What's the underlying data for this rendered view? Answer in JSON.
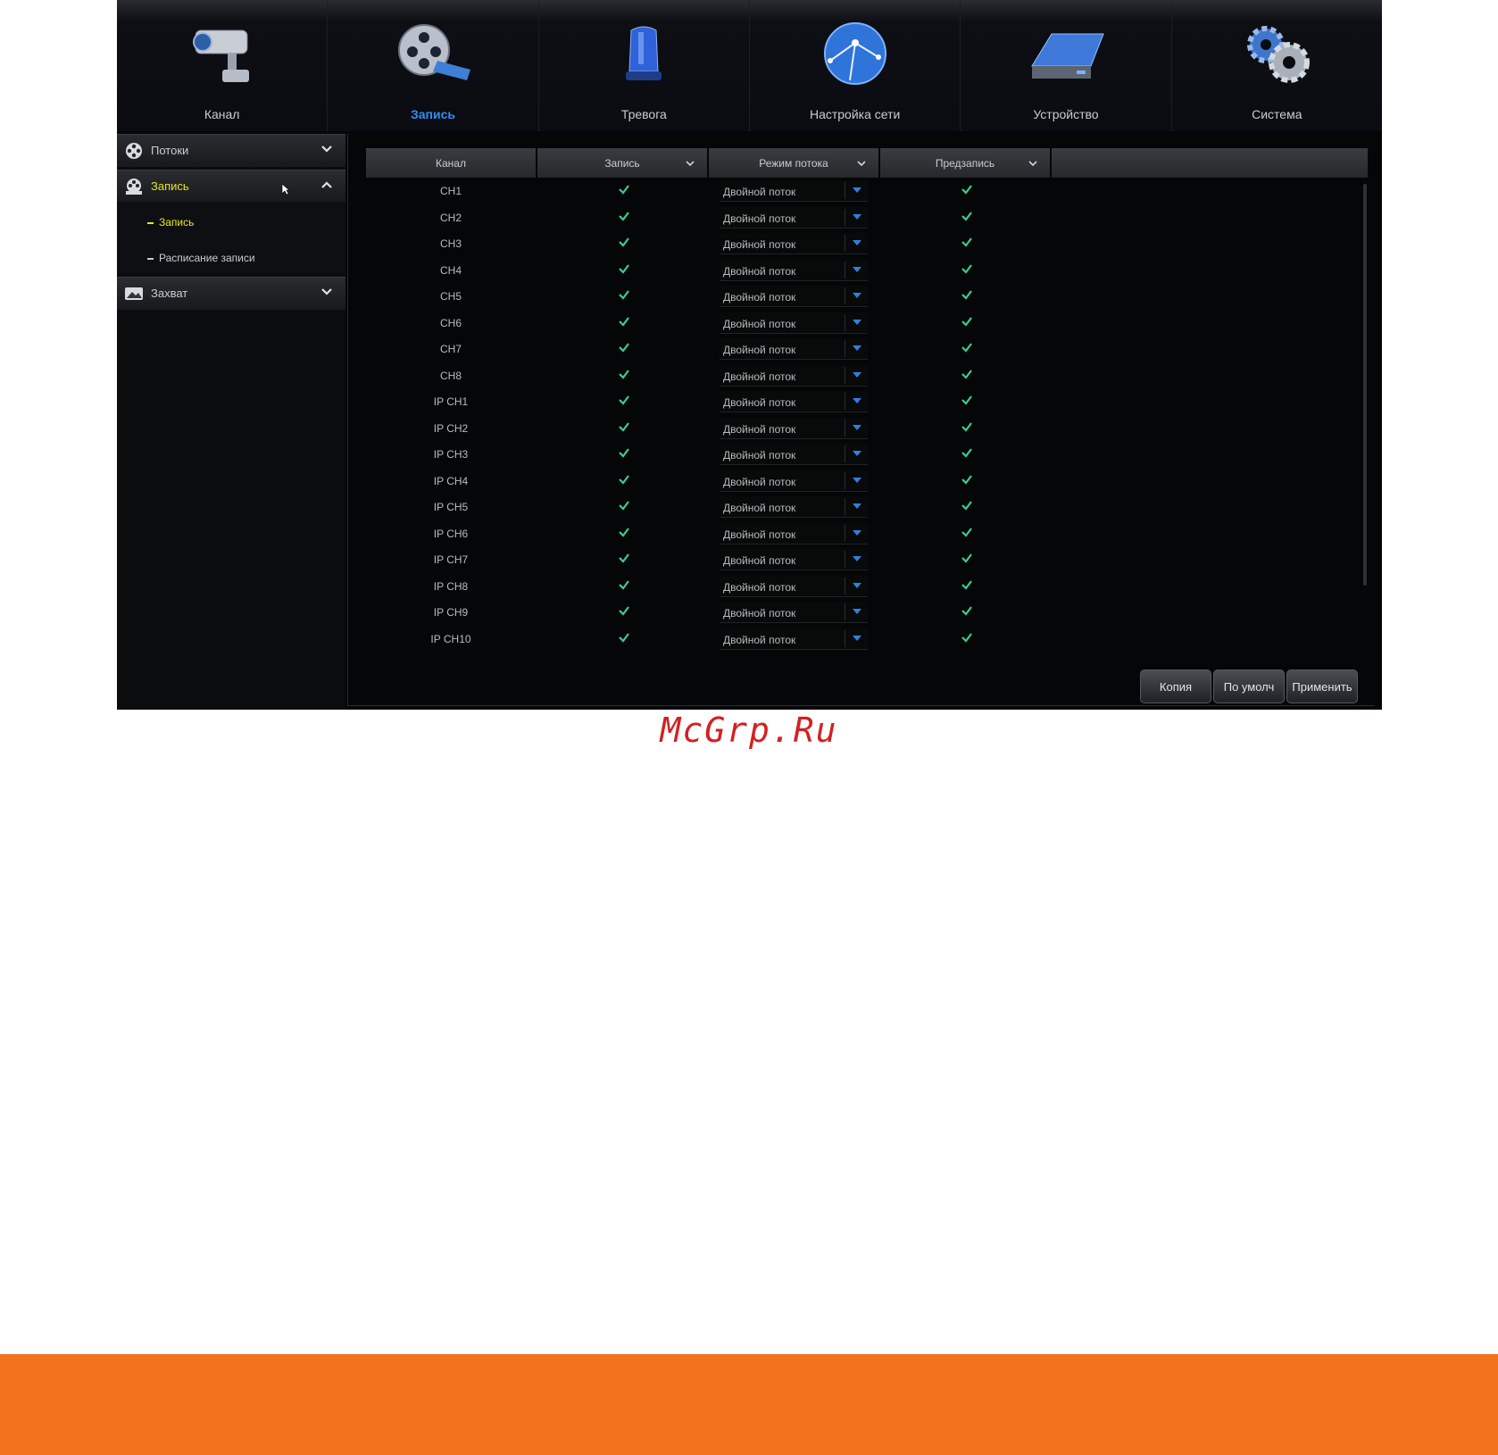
{
  "nav": {
    "tabs": [
      {
        "label": "Канал",
        "icon": "camera-icon"
      },
      {
        "label": "Запись",
        "icon": "film-reel-icon",
        "active": true
      },
      {
        "label": "Тревога",
        "icon": "alarm-siren-icon"
      },
      {
        "label": "Настройка сети",
        "icon": "globe-network-icon"
      },
      {
        "label": "Устройство",
        "icon": "hard-drive-icon"
      },
      {
        "label": "Система",
        "icon": "gears-icon"
      }
    ]
  },
  "sidebar": {
    "sections": [
      {
        "label": "Потоки",
        "icon": "film-icon",
        "expanded": false
      },
      {
        "label": "Запись",
        "icon": "record-reel-icon",
        "expanded": true,
        "items": [
          {
            "label": "Запись",
            "active": true
          },
          {
            "label": "Расписание записи",
            "active": false
          }
        ]
      },
      {
        "label": "Захват",
        "icon": "capture-image-icon",
        "expanded": false
      }
    ]
  },
  "table": {
    "columns": [
      "Канал",
      "Запись",
      "Режим потока",
      "Предзапись"
    ],
    "rows": [
      {
        "channel": "CH1",
        "record": true,
        "mode": "Двойной поток",
        "prerecord": true
      },
      {
        "channel": "CH2",
        "record": true,
        "mode": "Двойной поток",
        "prerecord": true
      },
      {
        "channel": "CH3",
        "record": true,
        "mode": "Двойной поток",
        "prerecord": true
      },
      {
        "channel": "CH4",
        "record": true,
        "mode": "Двойной поток",
        "prerecord": true
      },
      {
        "channel": "CH5",
        "record": true,
        "mode": "Двойной поток",
        "prerecord": true
      },
      {
        "channel": "CH6",
        "record": true,
        "mode": "Двойной поток",
        "prerecord": true
      },
      {
        "channel": "CH7",
        "record": true,
        "mode": "Двойной поток",
        "prerecord": true
      },
      {
        "channel": "CH8",
        "record": true,
        "mode": "Двойной поток",
        "prerecord": true
      },
      {
        "channel": "IP CH1",
        "record": true,
        "mode": "Двойной поток",
        "prerecord": true
      },
      {
        "channel": "IP CH2",
        "record": true,
        "mode": "Двойной поток",
        "prerecord": true
      },
      {
        "channel": "IP CH3",
        "record": true,
        "mode": "Двойной поток",
        "prerecord": true
      },
      {
        "channel": "IP CH4",
        "record": true,
        "mode": "Двойной поток",
        "prerecord": true
      },
      {
        "channel": "IP CH5",
        "record": true,
        "mode": "Двойной поток",
        "prerecord": true
      },
      {
        "channel": "IP CH6",
        "record": true,
        "mode": "Двойной поток",
        "prerecord": true
      },
      {
        "channel": "IP CH7",
        "record": true,
        "mode": "Двойной поток",
        "prerecord": true
      },
      {
        "channel": "IP CH8",
        "record": true,
        "mode": "Двойной поток",
        "prerecord": true
      },
      {
        "channel": "IP CH9",
        "record": true,
        "mode": "Двойной поток",
        "prerecord": true
      },
      {
        "channel": "IP CH10",
        "record": true,
        "mode": "Двойной поток",
        "prerecord": true
      }
    ]
  },
  "buttons": {
    "copy": "Копия",
    "default": "По умолч",
    "apply": "Применить"
  },
  "watermark": "McGrp.Ru",
  "colors": {
    "active_tab": "#2f8ef5",
    "active_sidebar": "#e6e61a",
    "check": "#38d08a",
    "footer": "#f2731b",
    "watermark": "#d42020"
  }
}
